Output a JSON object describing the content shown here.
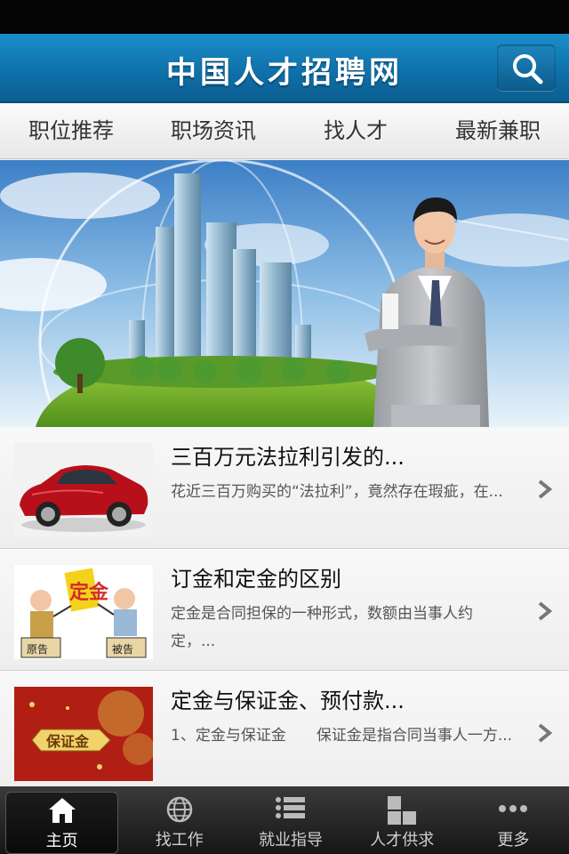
{
  "header": {
    "title": "中国人才招聘网"
  },
  "nav": {
    "tabs": [
      "职位推荐",
      "职场资讯",
      "找人才",
      "最新兼职"
    ]
  },
  "banner": {
    "slide_count": 5,
    "active_index": 0
  },
  "articles": [
    {
      "title": "三百万元法拉利引发的...",
      "desc": "花近三百万购买的“法拉利”，竟然存在瑕疵，在..."
    },
    {
      "title": "订金和定金的区别",
      "desc": "定金是合同担保的一种形式，数额由当事人约定，..."
    },
    {
      "title": "定金与保证金、预付款...",
      "desc": "1、定金与保证金　　保证金是指合同当事人一方..."
    }
  ],
  "thumb_labels": {
    "plaintiff": "原告",
    "defendant": "被告",
    "deposit": "定金",
    "guarantee": "保证金"
  },
  "tabbar": {
    "items": [
      "主页",
      "找工作",
      "就业指导",
      "人才供求",
      "更多"
    ]
  },
  "colors": {
    "header_blue": "#0f6fa8",
    "tabbar_dark": "#1c1c1c"
  }
}
